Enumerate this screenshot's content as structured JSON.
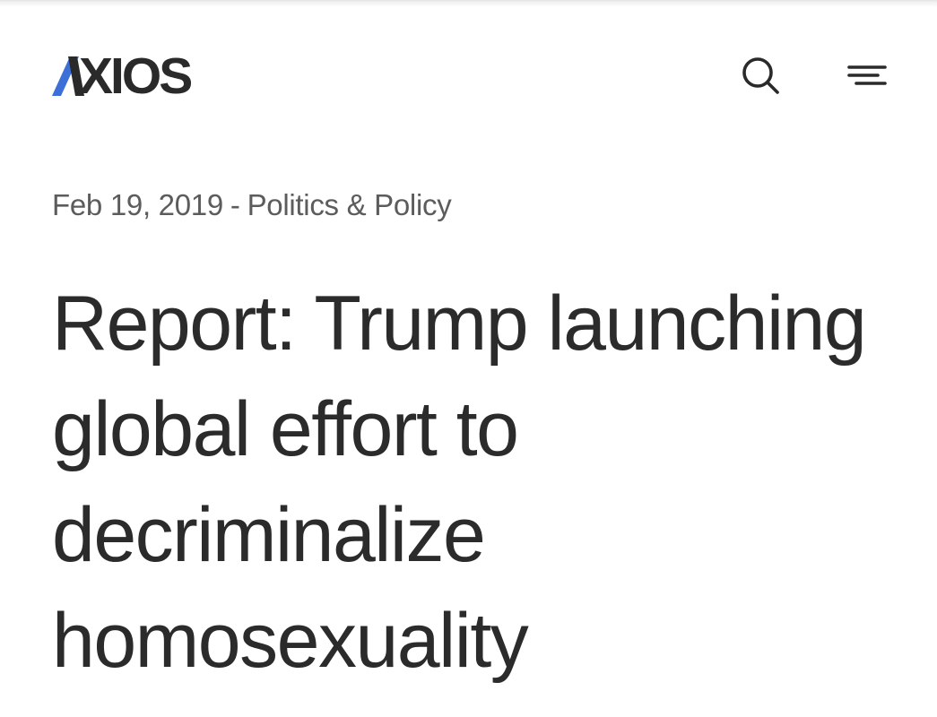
{
  "header": {
    "logo_text": "XIOS",
    "logo_slash_color": "#3d6fd9",
    "search_icon": "search-icon",
    "menu_icon": "hamburger-menu-icon"
  },
  "article": {
    "date": "Feb 19, 2019",
    "separator": "-",
    "category": "Politics & Policy",
    "headline": "Report: Trump launching global effort to decriminalize homosexuality"
  }
}
